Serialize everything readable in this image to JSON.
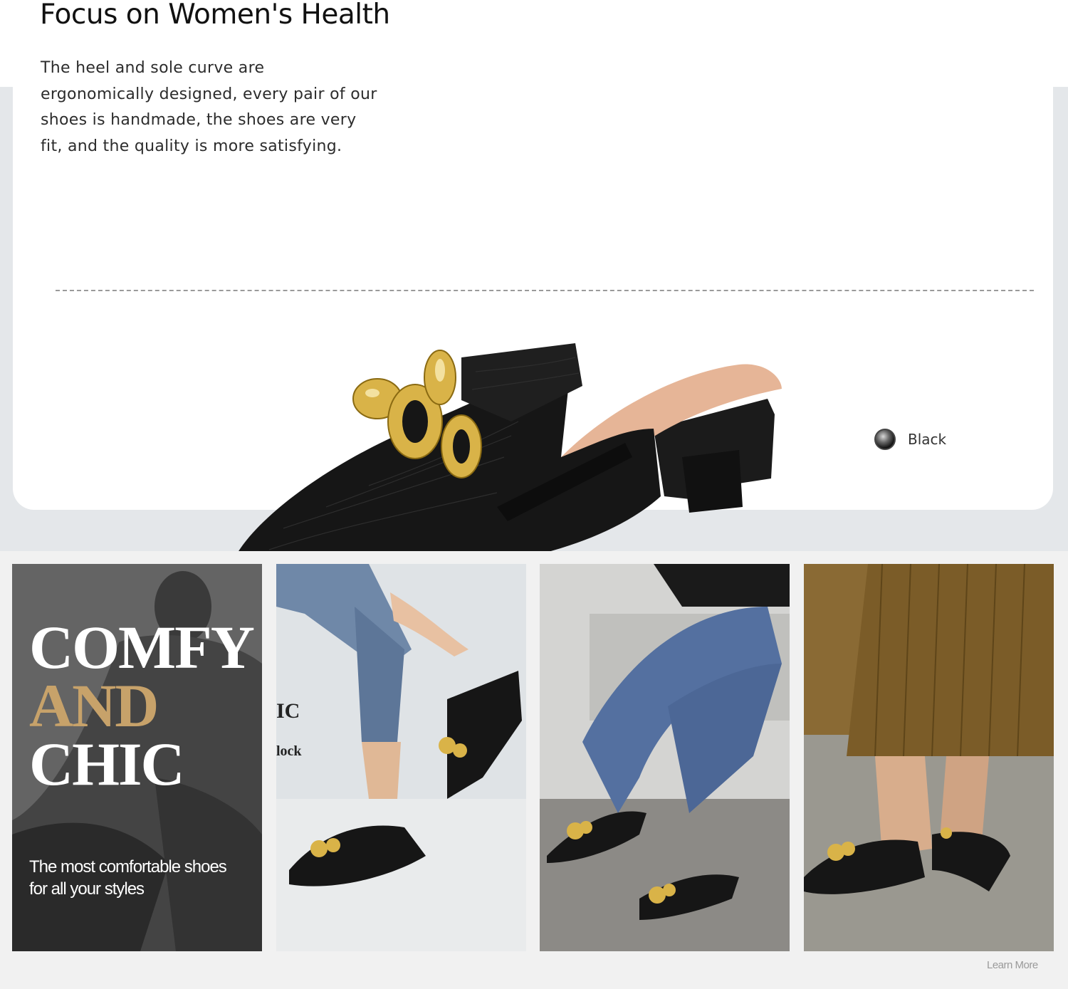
{
  "header": {
    "title": "Focus on Women's Health",
    "description": "The heel and sole curve are ergonomically designed, every pair of our shoes is handmade, the shoes are very fit, and the quality is more satisfying."
  },
  "product": {
    "color_option": {
      "label": "Black",
      "swatch_color": "#1a1a1a"
    }
  },
  "gallery": {
    "banner": {
      "line1": "COMFY",
      "line2": "AND",
      "line3": "CHIC",
      "tagline": "The most comfortable shoes for all your styles"
    },
    "overlay_fragment_1": "IC",
    "overlay_fragment_2": "lock"
  },
  "footer": {
    "learn_more": "Learn More"
  },
  "colors": {
    "accent_gold": "#c7a26a",
    "background_gray": "#e4e7ea",
    "shoe_black": "#161616"
  }
}
